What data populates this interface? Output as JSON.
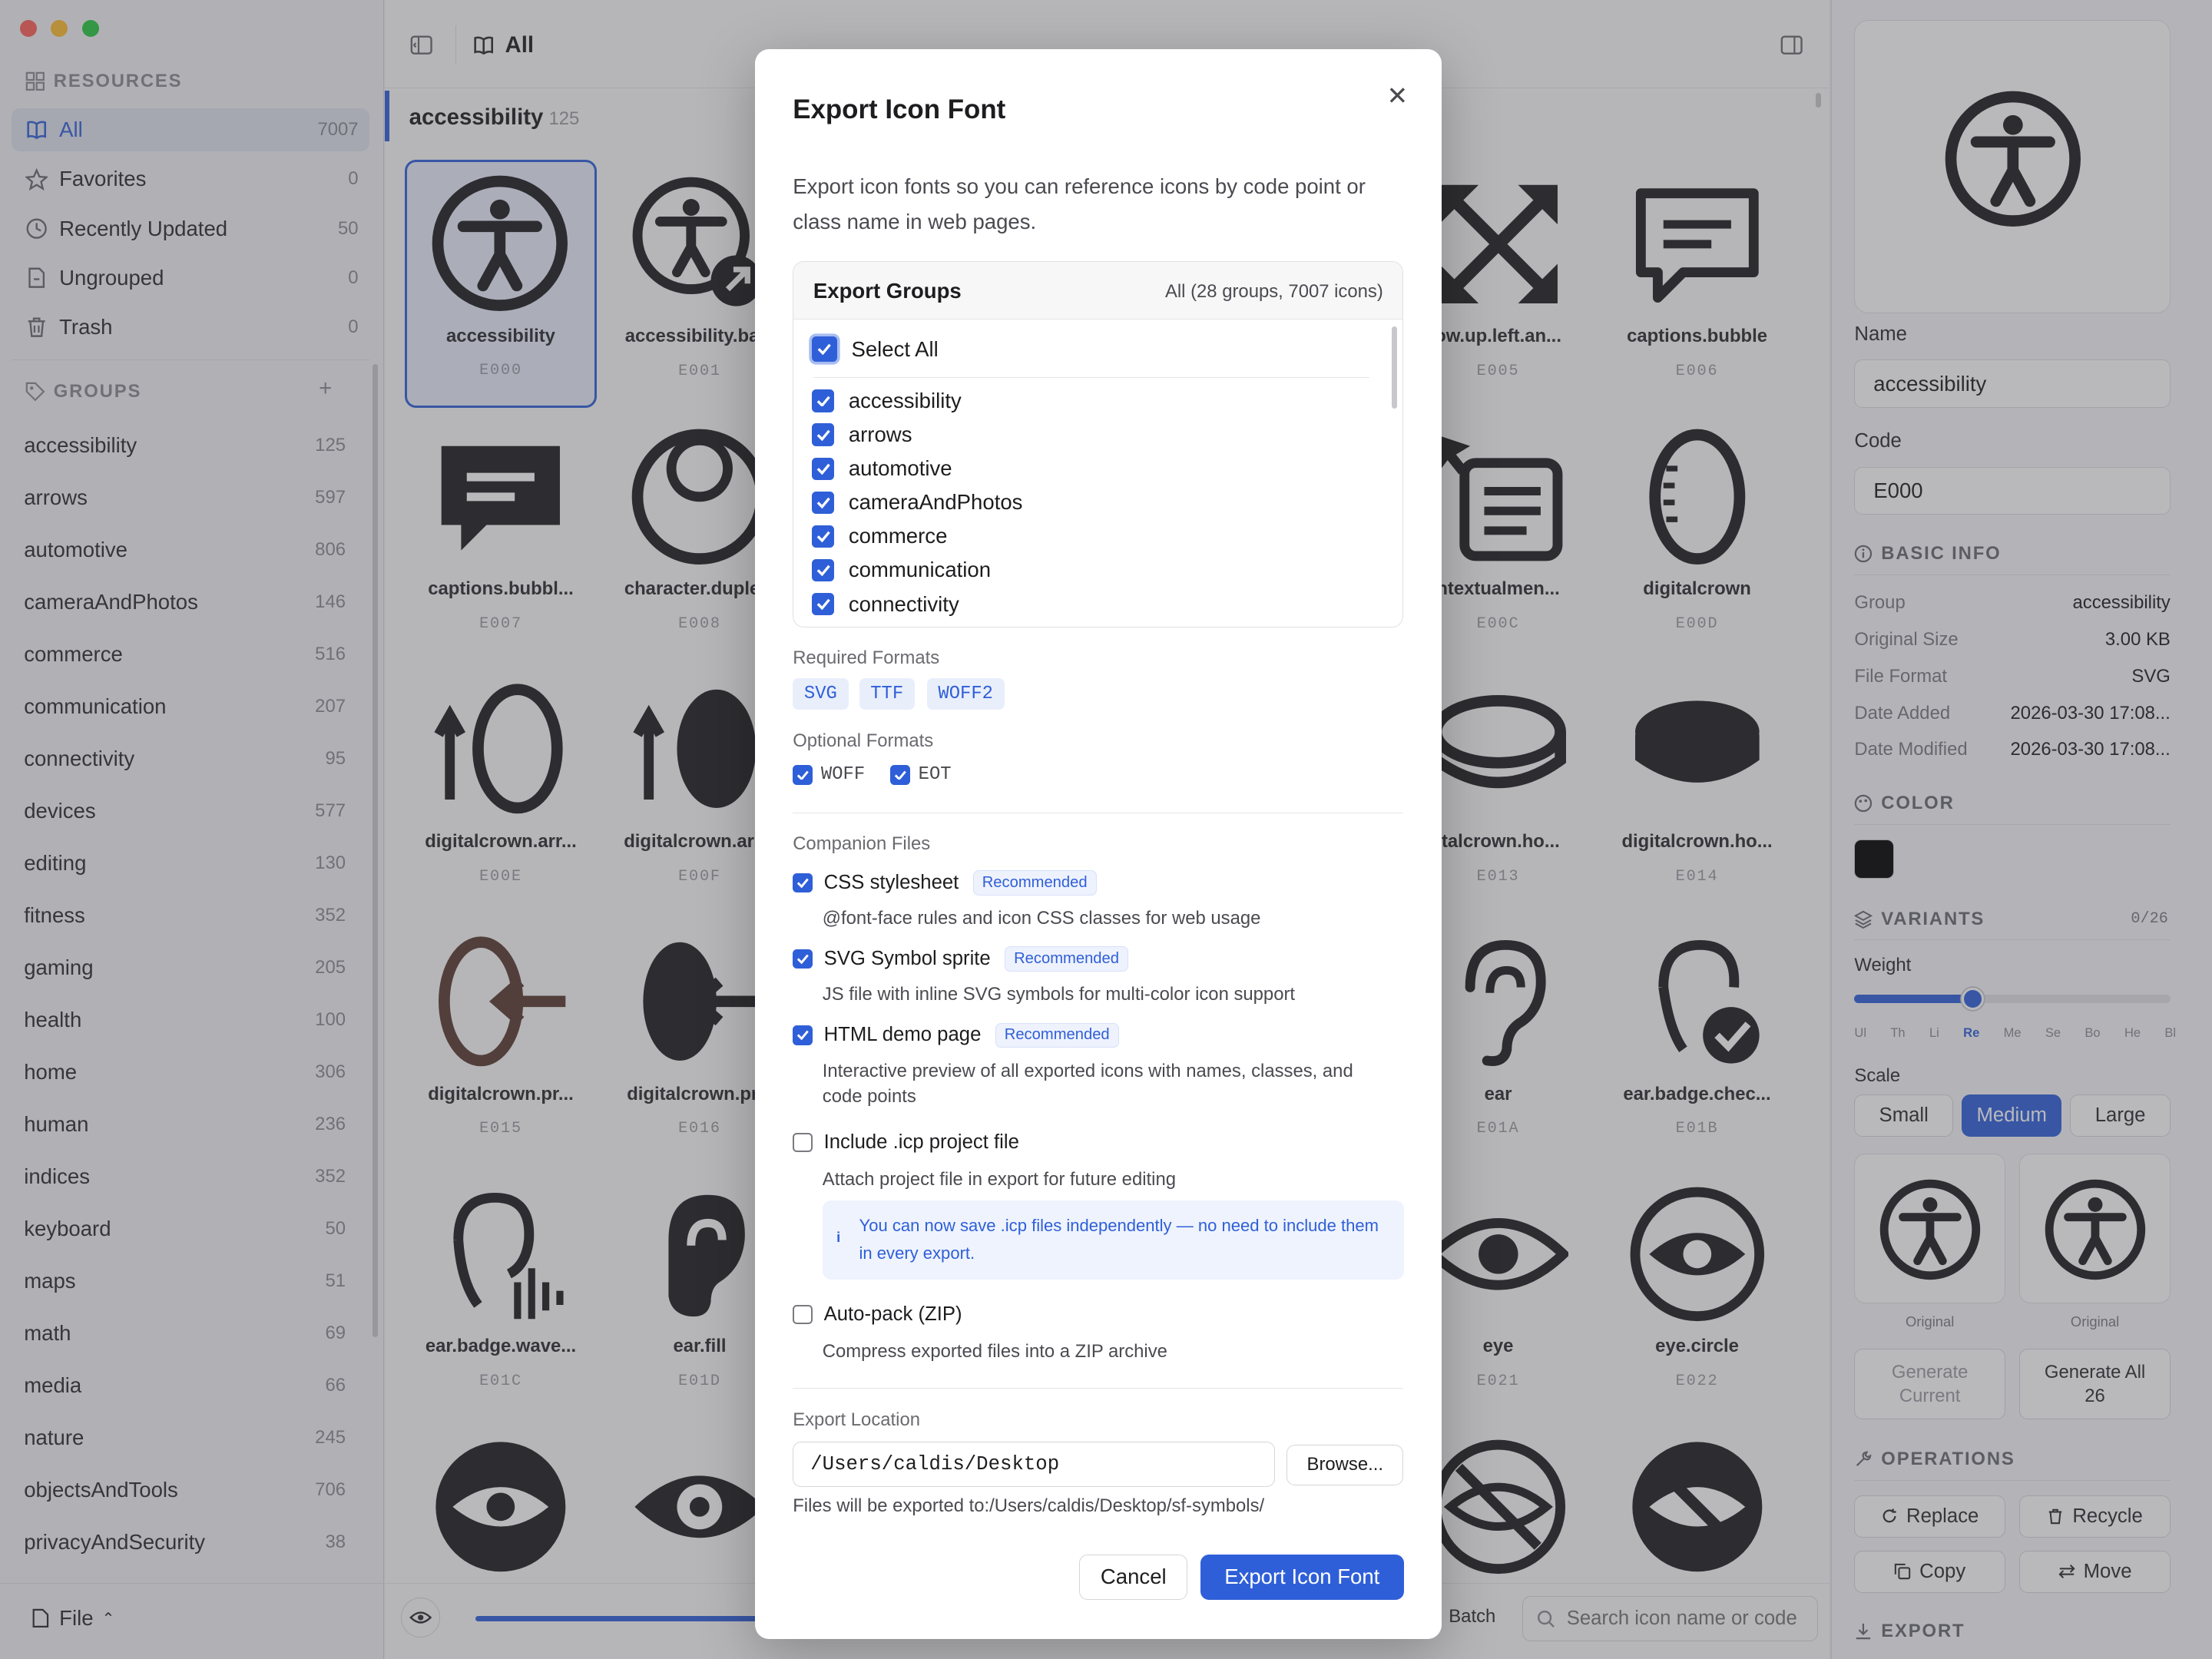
{
  "sidebar": {
    "resources_title": "RESOURCES",
    "resources": [
      {
        "label": "All",
        "count": "7007"
      },
      {
        "label": "Favorites",
        "count": "0"
      },
      {
        "label": "Recently Updated",
        "count": "50"
      },
      {
        "label": "Ungrouped",
        "count": "0"
      },
      {
        "label": "Trash",
        "count": "0"
      }
    ],
    "groups_title": "GROUPS",
    "groups": [
      {
        "label": "accessibility",
        "count": "125"
      },
      {
        "label": "arrows",
        "count": "597"
      },
      {
        "label": "automotive",
        "count": "806"
      },
      {
        "label": "cameraAndPhotos",
        "count": "146"
      },
      {
        "label": "commerce",
        "count": "516"
      },
      {
        "label": "communication",
        "count": "207"
      },
      {
        "label": "connectivity",
        "count": "95"
      },
      {
        "label": "devices",
        "count": "577"
      },
      {
        "label": "editing",
        "count": "130"
      },
      {
        "label": "fitness",
        "count": "352"
      },
      {
        "label": "gaming",
        "count": "205"
      },
      {
        "label": "health",
        "count": "100"
      },
      {
        "label": "home",
        "count": "306"
      },
      {
        "label": "human",
        "count": "236"
      },
      {
        "label": "indices",
        "count": "352"
      },
      {
        "label": "keyboard",
        "count": "50"
      },
      {
        "label": "maps",
        "count": "51"
      },
      {
        "label": "math",
        "count": "69"
      },
      {
        "label": "media",
        "count": "66"
      },
      {
        "label": "nature",
        "count": "245"
      },
      {
        "label": "objectsAndTools",
        "count": "706"
      },
      {
        "label": "privacyAndSecurity",
        "count": "38"
      }
    ],
    "file_label": "File"
  },
  "main": {
    "header_title": "All",
    "section_title": "accessibility",
    "section_count": "125",
    "cells": [
      {
        "name": "accessibility",
        "code": "E000"
      },
      {
        "name": "accessibility.ba...",
        "code": "E001"
      },
      {
        "name": "ow.up.left.an...",
        "code": "E005"
      },
      {
        "name": "captions.bubble",
        "code": "E006"
      },
      {
        "name": "captions.bubbl...",
        "code": "E007"
      },
      {
        "name": "character.duple...",
        "code": "E008"
      },
      {
        "name": "ntextualmen...",
        "code": "E00C"
      },
      {
        "name": "digitalcrown",
        "code": "E00D"
      },
      {
        "name": "digitalcrown.arr...",
        "code": "E00E"
      },
      {
        "name": "digitalcrown.arr...",
        "code": "E00F"
      },
      {
        "name": "italcrown.ho...",
        "code": "E013"
      },
      {
        "name": "digitalcrown.ho...",
        "code": "E014"
      },
      {
        "name": "digitalcrown.pr...",
        "code": "E015"
      },
      {
        "name": "digitalcrown.pr...",
        "code": "E016"
      },
      {
        "name": "ear",
        "code": "E01A"
      },
      {
        "name": "ear.badge.chec...",
        "code": "E01B"
      },
      {
        "name": "ear.badge.wave...",
        "code": "E01C"
      },
      {
        "name": "ear.fill",
        "code": "E01D"
      },
      {
        "name": "eye",
        "code": "E021"
      },
      {
        "name": "eye.circle",
        "code": "E022"
      }
    ],
    "batch_label": "Batch",
    "search_placeholder": "Search icon name or code"
  },
  "right": {
    "name_label": "Name",
    "name_value": "accessibility",
    "code_label": "Code",
    "code_value": "E000",
    "basic_info_title": "BASIC INFO",
    "info": [
      {
        "k": "Group",
        "v": "accessibility"
      },
      {
        "k": "Original Size",
        "v": "3.00 KB"
      },
      {
        "k": "File Format",
        "v": "SVG"
      },
      {
        "k": "Date Added",
        "v": "2026-03-30 17:08..."
      },
      {
        "k": "Date Modified",
        "v": "2026-03-30 17:08..."
      }
    ],
    "color_title": "COLOR",
    "color_value": "#000000",
    "variants_title": "VARIANTS",
    "variants_count": "0/26",
    "weight_label": "Weight",
    "weight_ticks": [
      "Ul",
      "Th",
      "Li",
      "Re",
      "Me",
      "Se",
      "Bo",
      "He",
      "Bl"
    ],
    "weight_selected": "Re",
    "weight_level": 0.375,
    "scale_label": "Scale",
    "scale_options": [
      "Small",
      "Medium",
      "Large"
    ],
    "scale_selected": "Medium",
    "variant_caption_1": "Original",
    "variant_caption_2": "Original",
    "generate_current": "Generate Current",
    "generate_all": "Generate All 26",
    "operations_title": "OPERATIONS",
    "ops": [
      "Replace",
      "Recycle",
      "Copy",
      "Move"
    ],
    "export_title": "EXPORT"
  },
  "modal": {
    "title": "Export Icon Font",
    "description": "Export icon fonts so you can reference icons by code point or class name in web pages.",
    "export_groups_title": "Export Groups",
    "export_groups_summary": "All (28 groups, 7007 icons)",
    "select_all_label": "Select All",
    "groups": [
      "accessibility",
      "arrows",
      "automotive",
      "cameraAndPhotos",
      "commerce",
      "communication",
      "connectivity"
    ],
    "required_formats_label": "Required Formats",
    "required_formats": [
      "SVG",
      "TTF",
      "WOFF2"
    ],
    "optional_formats_label": "Optional Formats",
    "optional_formats": [
      {
        "label": "WOFF",
        "checked": true
      },
      {
        "label": "EOT",
        "checked": true
      }
    ],
    "companion_label": "Companion Files",
    "companions": [
      {
        "label": "CSS stylesheet",
        "badge": "Recommended",
        "desc": "@font-face rules and icon CSS classes for web usage"
      },
      {
        "label": "SVG Symbol sprite",
        "badge": "Recommended",
        "desc": "JS file with inline SVG symbols for multi-color icon support"
      },
      {
        "label": "HTML demo page",
        "badge": "Recommended",
        "desc": "Interactive preview of all exported icons with names, classes, and code points"
      }
    ],
    "icp_label": "Include .icp project file",
    "icp_desc": "Attach project file in export for future editing",
    "icp_info": "You can now save .icp files independently — no need to include them in every export.",
    "zip_label": "Auto-pack (ZIP)",
    "zip_desc": "Compress exported files into a ZIP archive",
    "location_label": "Export Location",
    "location_value": "/Users/caldis/Desktop",
    "browse_label": "Browse...",
    "export_path_note": "Files will be exported to:/Users/caldis/Desktop/sf-symbols/",
    "cancel_label": "Cancel",
    "export_label": "Export Icon Font",
    "accent_color": "#2f5fd8"
  }
}
